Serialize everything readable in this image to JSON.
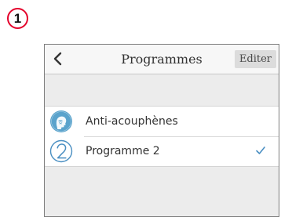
{
  "step": {
    "number": "1"
  },
  "nav": {
    "back_icon": "chevron-left-icon",
    "title": "Programmes",
    "edit_label": "Editer"
  },
  "programs": [
    {
      "label": "Anti-acouphènes",
      "icon": "tinnitus-head-icon",
      "selected": false
    },
    {
      "label": "Programme 2",
      "icon": "number-two-icon",
      "selected": true
    }
  ],
  "colors": {
    "badge_ring": "#e4002b",
    "accent": "#4a8fc2",
    "icon_fill": "#5aa3cc"
  }
}
